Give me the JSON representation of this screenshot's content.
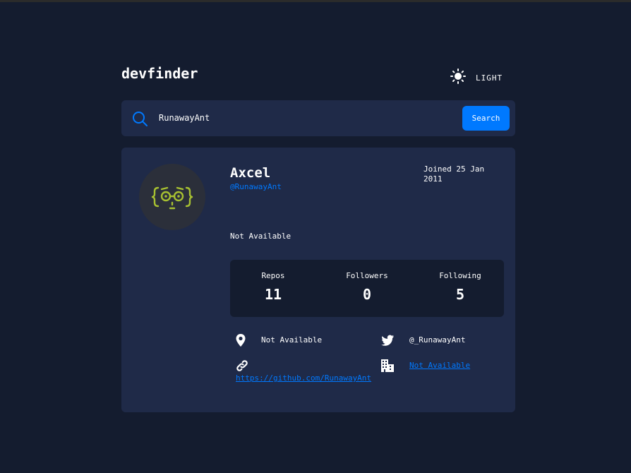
{
  "header": {
    "logo": "devfinder",
    "theme_label": "LIGHT"
  },
  "search": {
    "value": "RunawayAnt",
    "placeholder": "",
    "button_label": "Search"
  },
  "profile": {
    "name": "Axcel",
    "login": "@RunawayAnt",
    "joined_line1": "Joined 25 Jan",
    "joined_line2": "2011",
    "bio": "Not Available",
    "stats": [
      {
        "label": "Repos",
        "value": "11"
      },
      {
        "label": "Followers",
        "value": "0"
      },
      {
        "label": "Following",
        "value": "5"
      }
    ],
    "location": "Not Available",
    "twitter": "@_RunawayAnt",
    "blog": "https://github.com/RunawayAnt",
    "company": "Not Available"
  },
  "icons": {
    "theme": "sun-icon",
    "search": "search-icon",
    "location": "location-pin-icon",
    "twitter": "twitter-icon",
    "blog": "link-icon",
    "company": "building-icon"
  },
  "colors": {
    "background": "#141c2f",
    "card": "#1f2a48",
    "accent": "#0079ff",
    "avatar_glyph": "#a7c031"
  }
}
